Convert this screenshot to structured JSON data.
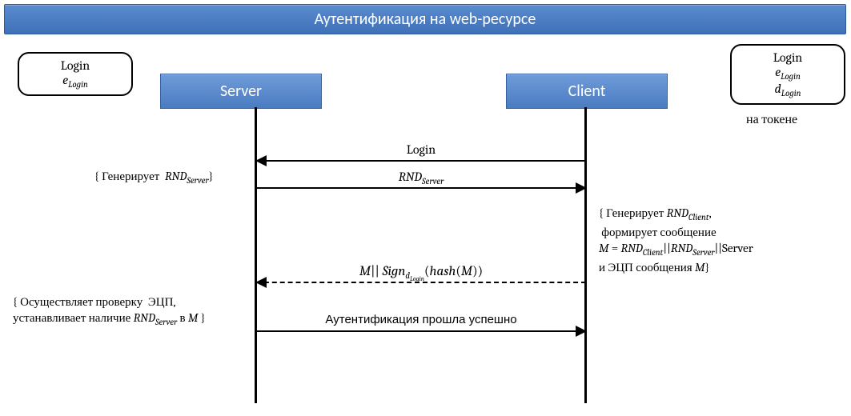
{
  "title": "Аутентификация на web-ресурсе",
  "left_box": {
    "line1": "Login",
    "line2_html": "<span class='ital'>e</span><sub class='sub'>Login</sub>"
  },
  "right_box": {
    "line1": "Login",
    "line2_html": "<span class='ital'>e</span><sub class='sub'>Login</sub>",
    "line3_html": "<span class='ital'>d</span><sub class='sub'>Login</sub>",
    "caption": "на токене"
  },
  "participants": {
    "server": "Server",
    "client": "Client"
  },
  "messages": {
    "m1": {
      "label_html": "Login",
      "direction": "left",
      "dashed": false
    },
    "m2": {
      "label_html": "<span class='ital'>RND</span><sub class='sub'>Server</sub>",
      "direction": "right",
      "dashed": false
    },
    "m3": {
      "label_html": "<span class='ital'>M</span>||&nbsp;<span class='ital'>Sign</span><sub class='sub'>d<sub style='font-size:8px'>Login</sub></sub>(<span class='ital'>hash</span>(<span class='ital'>M</span>))",
      "direction": "left",
      "dashed": true
    },
    "m4": {
      "label_html": "Аутентификация прошла успешно",
      "direction": "right",
      "dashed": false
    }
  },
  "notes": {
    "n1_html": "{ Генерирует &nbsp;<span class='ital'>RND</span><sub class='sub'>Server</sub>}",
    "n2_html": "{ Генерирует <span class='ital'>RND</span><sub class='sub'>Client</sub>,<br>&nbsp;формирует сообщение<br><span class='ital'>M</span> = <span class='ital'>RND</span><sub class='sub'>Client</sub>||<span class='ital'>RND</span><sub class='sub'>Server</sub>||Server<br>и ЭЦП сообщения <span class='ital'>M</span>}",
    "n3_html": "{ Осуществляет проверку &nbsp;ЭЦП,<br>устанавливает наличие <span class='ital'>RND</span><sub class='sub'>Server</sub> в <span class='ital'>M</span> }"
  },
  "chart_data": {
    "type": "sequence-diagram",
    "title": "Аутентификация на web-ресурсе",
    "participants": [
      "Server",
      "Client"
    ],
    "left_knowledge": {
      "owner": "Server-side",
      "items": [
        "Login",
        "e_Login"
      ]
    },
    "right_knowledge": {
      "owner": "Client (на токене)",
      "items": [
        "Login",
        "e_Login",
        "d_Login"
      ]
    },
    "messages": [
      {
        "from": "Client",
        "to": "Server",
        "label": "Login",
        "style": "solid"
      },
      {
        "from": "Server",
        "to": "Client",
        "label": "RND_Server",
        "style": "solid",
        "before_note": {
          "at": "Server",
          "text": "Генерирует RND_Server"
        }
      },
      {
        "from": "Client",
        "to": "Server",
        "label": "M || Sign_{d_Login}(hash(M))",
        "style": "dashed",
        "before_note": {
          "at": "Client",
          "text": "Генерирует RND_Client, формирует сообщение M = RND_Client || RND_Server || Server и ЭЦП сообщения M"
        }
      },
      {
        "from": "Server",
        "to": "Client",
        "label": "Аутентификация прошла успешно",
        "style": "solid",
        "before_note": {
          "at": "Server",
          "text": "Осуществляет проверку ЭЦП, устанавливает наличие RND_Server в M"
        }
      }
    ]
  }
}
